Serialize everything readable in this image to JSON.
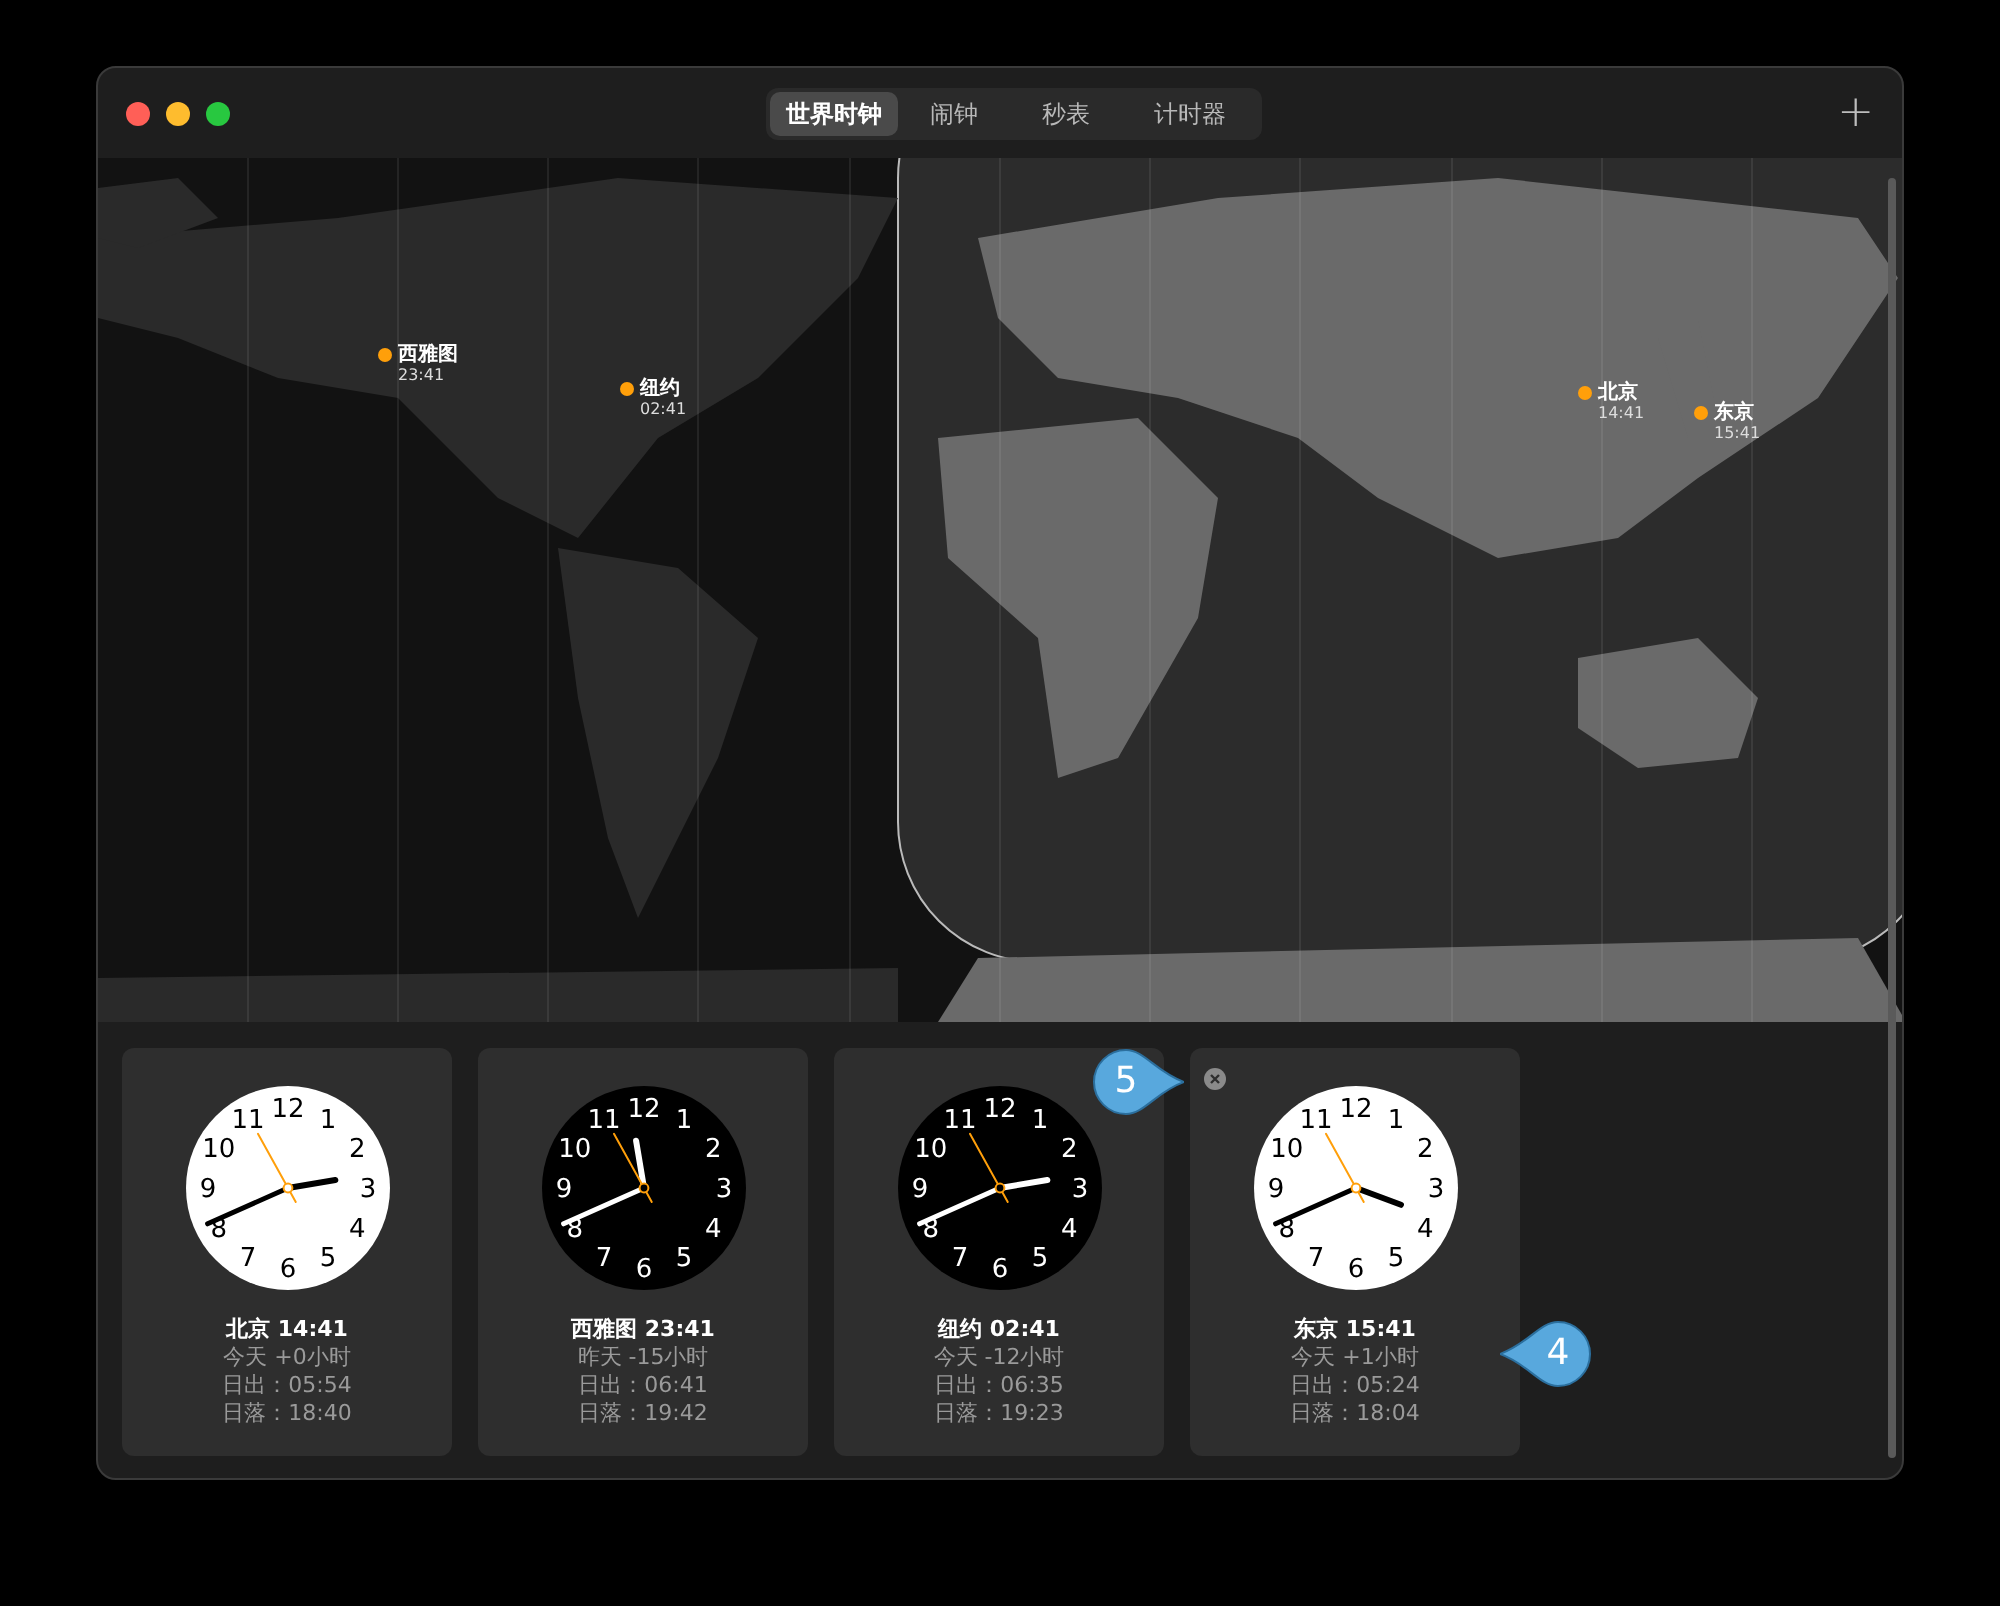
{
  "tabs": [
    {
      "label": "世界时钟",
      "selected": true
    },
    {
      "label": "闹钟",
      "selected": false
    },
    {
      "label": "秒表",
      "selected": false
    },
    {
      "label": "计时器",
      "selected": false
    }
  ],
  "add_button": "+",
  "map": {
    "pins": [
      {
        "city": "西雅图",
        "time": "23:41"
      },
      {
        "city": "纽约",
        "time": "02:41"
      },
      {
        "city": "北京",
        "time": "14:41"
      },
      {
        "city": "东京",
        "time": "15:41"
      }
    ]
  },
  "clocks": [
    {
      "dial": [
        "11",
        "12",
        "1",
        "10",
        "2",
        "9",
        "3",
        "8",
        "4",
        "7",
        "6",
        "5"
      ],
      "title": "北京 14:41",
      "offset": "今天 +0小时",
      "sunrise": "日出：05:54",
      "sunset": "日落：18:40",
      "dark": false,
      "removable": false
    },
    {
      "dial": [
        "11",
        "12",
        "1",
        "10",
        "2",
        "9",
        "3",
        "8",
        "4",
        "7",
        "6",
        "5"
      ],
      "title": "西雅图 23:41",
      "offset": "昨天 -15小时",
      "sunrise": "日出：06:41",
      "sunset": "日落：19:42",
      "dark": true,
      "removable": false
    },
    {
      "dial": [
        "11",
        "12",
        "1",
        "10",
        "2",
        "9",
        "3",
        "8",
        "4",
        "7",
        "6",
        "5"
      ],
      "title": "纽约 02:41",
      "offset": "今天 -12小时",
      "sunrise": "日出：06:35",
      "sunset": "日落：19:23",
      "dark": true,
      "removable": false
    },
    {
      "dial": [
        "11",
        "12",
        "1",
        "10",
        "2",
        "9",
        "3",
        "8",
        "4",
        "7",
        "6",
        "5"
      ],
      "title": "东京 15:41",
      "offset": "今天 +1小时",
      "sunrise": "日出：05:24",
      "sunset": "日落：18:04",
      "dark": false,
      "removable": true
    }
  ],
  "callouts": [
    {
      "label": "5",
      "points_left": false
    },
    {
      "label": "4",
      "points_left": true
    }
  ]
}
